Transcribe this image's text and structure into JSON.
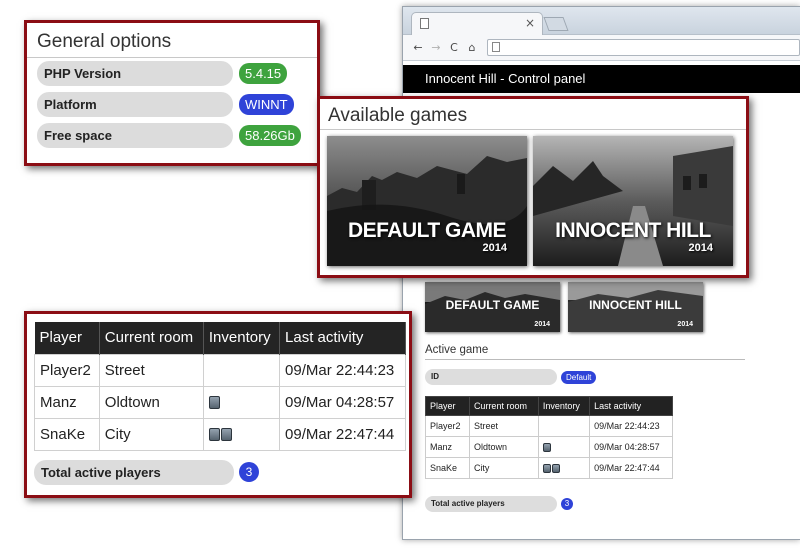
{
  "browser": {
    "tab_close": "×",
    "nav": {
      "back": "←",
      "forward": "→",
      "reload": "C",
      "home": "⌂"
    },
    "header_title": "Innocent Hill - Control panel"
  },
  "general_options": {
    "title": "General options",
    "rows": [
      {
        "label": "PHP Version",
        "value": "5.4.15",
        "color": "#3ea33e"
      },
      {
        "label": "Platform",
        "value": "WINNT",
        "color": "#2f43d8"
      },
      {
        "label": "Free space",
        "value": "58.26Gb",
        "color": "#3ea33e"
      }
    ]
  },
  "available_games": {
    "title": "Available games",
    "games": [
      {
        "title": "DEFAULT GAME",
        "year": "2014"
      },
      {
        "title": "INNOCENT HILL",
        "year": "2014"
      }
    ]
  },
  "active_game": {
    "section_title": "Active game",
    "id_label": "ID",
    "id_value": "Default"
  },
  "players": {
    "columns": [
      "Player",
      "Current room",
      "Inventory",
      "Last activity"
    ],
    "rows": [
      {
        "player": "Player2",
        "room": "Street",
        "inventory_count": 0,
        "last_activity": "09/Mar 22:44:23"
      },
      {
        "player": "Manz",
        "room": "Oldtown",
        "inventory_count": 1,
        "last_activity": "09/Mar 04:28:57"
      },
      {
        "player": "SnaKe",
        "room": "City",
        "inventory_count": 2,
        "last_activity": "09/Mar 22:47:44"
      }
    ],
    "total_label": "Total active players",
    "total_value": "3"
  },
  "colors": {
    "callout_border": "#8b0d14",
    "green_badge": "#3ea33e",
    "blue_badge": "#2f43d8"
  },
  "icons": [
    "page-icon",
    "close-icon",
    "back-icon",
    "forward-icon",
    "reload-icon",
    "home-icon",
    "inventory-item-icon"
  ]
}
